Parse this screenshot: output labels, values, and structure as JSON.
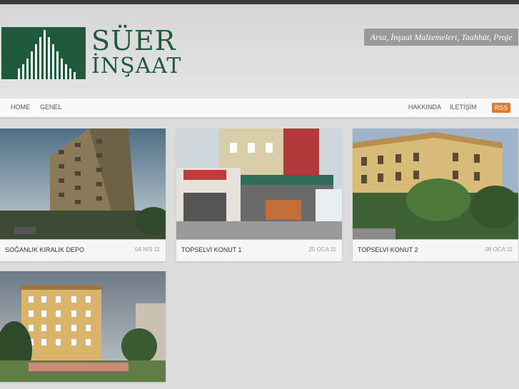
{
  "site": {
    "logo_line1": "SÜER",
    "logo_line2": "İNŞAAT",
    "tagline": "Arsa, İnşaat Malzemeleri, Taahhüt, Proje"
  },
  "nav": {
    "left": [
      "HOME",
      "GENEL"
    ],
    "right": [
      "HAKKINDA",
      "İLETİŞİM"
    ],
    "rss": "RSS"
  },
  "posts": [
    {
      "title": "SOĞANLIK KIRALIK DEPO",
      "date": "04 NIS 11"
    },
    {
      "title": "TOPSELVİ KONUT 1",
      "date": "25 OCA 11"
    },
    {
      "title": "TOPSELVİ KONUT 2",
      "date": "08 OCA 11"
    },
    {
      "title": "",
      "date": ""
    }
  ],
  "colors": {
    "brand": "#1f5a3c",
    "rss": "#e07b2a"
  }
}
